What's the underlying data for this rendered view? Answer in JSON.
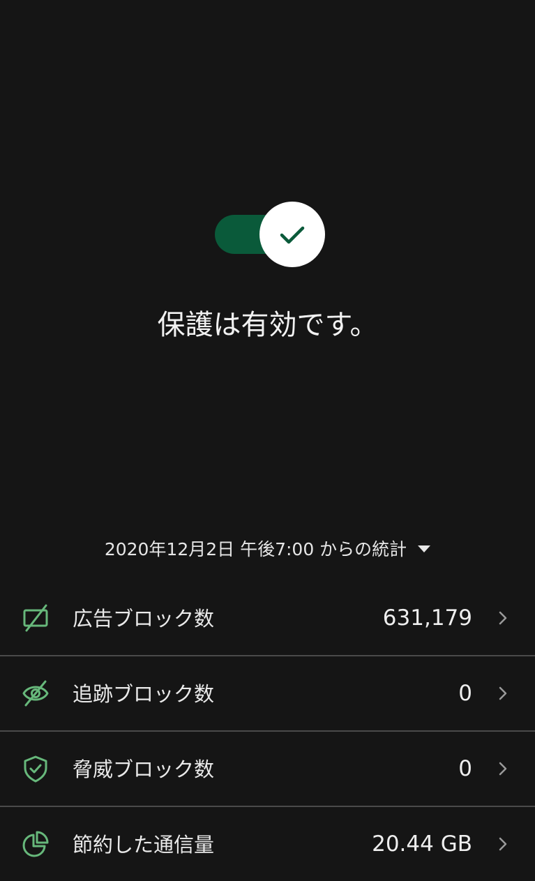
{
  "protection": {
    "enabled": true,
    "status_text": "保護は有効です。"
  },
  "stats_period": {
    "label": "2020年12月2日 午後7:00 からの統計"
  },
  "stats": [
    {
      "icon": "ad-block-icon",
      "label": "広告ブロック数",
      "value": "631,179"
    },
    {
      "icon": "tracking-block-icon",
      "label": "追跡ブロック数",
      "value": "0"
    },
    {
      "icon": "shield-check-icon",
      "label": "脅威ブロック数",
      "value": "0"
    },
    {
      "icon": "pie-chart-icon",
      "label": "節約した通信量",
      "value": "20.44 GB"
    }
  ],
  "colors": {
    "background": "#151515",
    "toggle_track": "#0a5a3a",
    "icon_green": "#67b87b",
    "divider": "#4a4a4a"
  }
}
